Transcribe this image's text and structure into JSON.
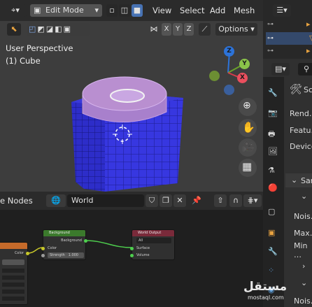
{
  "viewport": {
    "mode": "Edit Mode",
    "menus": [
      "View",
      "Select",
      "Add",
      "Mesh"
    ],
    "axes": [
      "X",
      "Y",
      "Z"
    ],
    "options_label": "Options",
    "view_name": "User Perspective",
    "object_name": "(1) Cube",
    "gizmo": {
      "z": "Z",
      "y": "Y",
      "x": "X"
    },
    "mesh_color": "#3737e0",
    "selected_color": "#b98fd0"
  },
  "node_editor": {
    "title": "e Nodes",
    "world_name": "World",
    "background_node": {
      "title": "Background",
      "output": "Background",
      "color_label": "Color",
      "strength_label": "Strength",
      "strength_value": "1.000"
    },
    "output_node": {
      "title": "World Output",
      "target": "All",
      "surface": "Surface",
      "volume": "Volume"
    },
    "partial_node_output": "Color"
  },
  "properties": {
    "labels": [
      "Rend…",
      "Featu…",
      "Device"
    ],
    "section_sam": "Sam",
    "labels2": [
      "Nois…",
      "Max…",
      "Min …",
      "Nois…"
    ],
    "tab_label_sc": "Sc"
  },
  "watermark": {
    "arabic": "مستقل",
    "latin": "mostaql.com"
  }
}
